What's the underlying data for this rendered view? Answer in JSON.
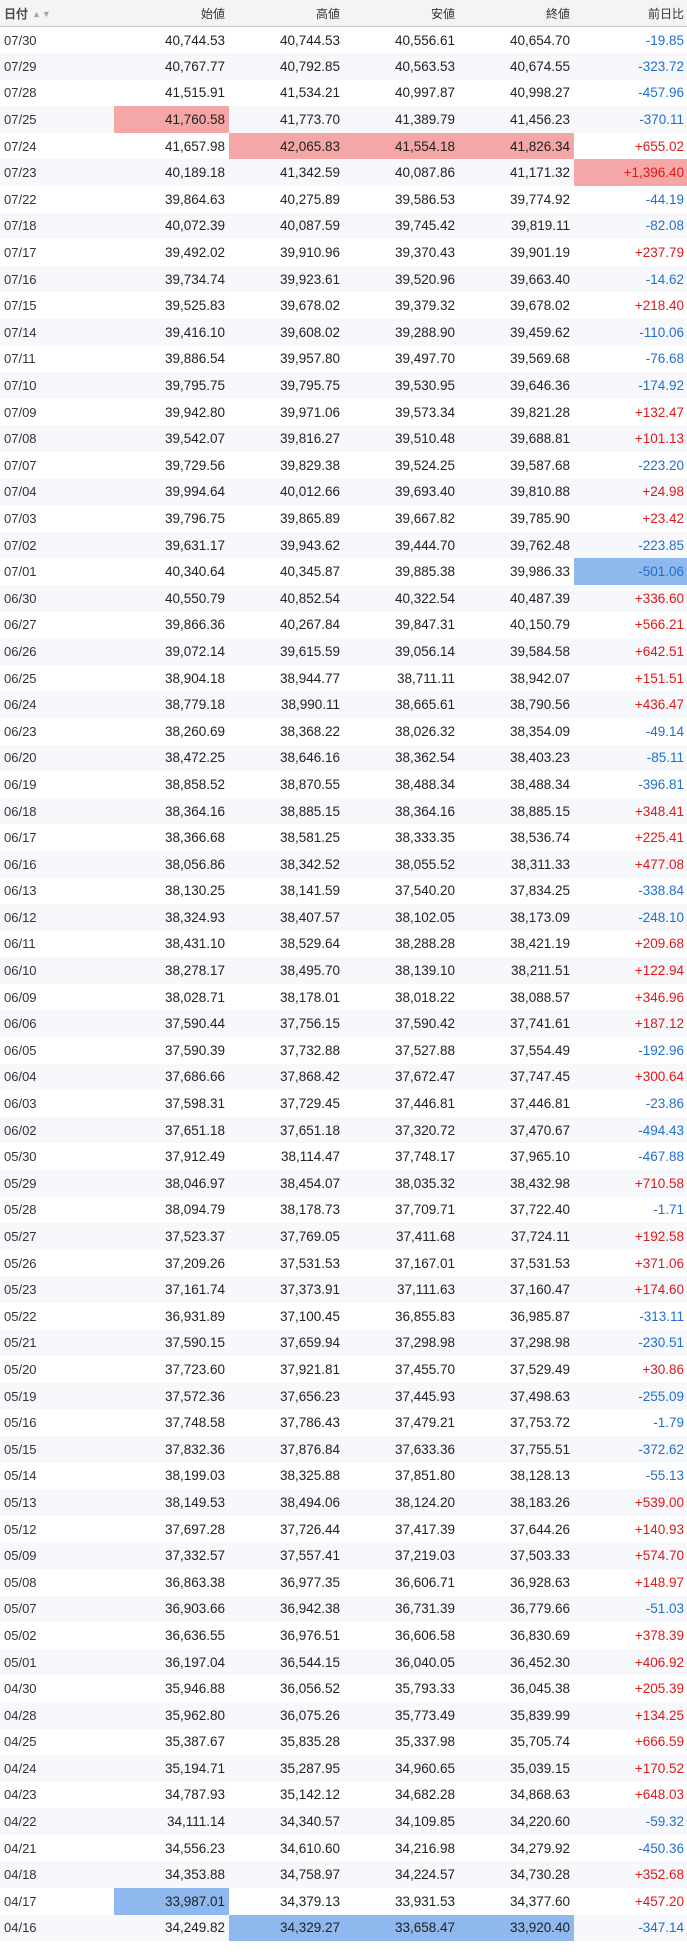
{
  "table": {
    "headers": {
      "date": "日付",
      "open": "始値",
      "high": "高値",
      "low": "安値",
      "close": "終値",
      "change": "前日比"
    },
    "rows": [
      [
        "07/30",
        "40,744.53",
        "40,744.53",
        "40,556.61",
        "40,654.70",
        "-19.85"
      ],
      [
        "07/29",
        "40,767.77",
        "40,792.85",
        "40,563.53",
        "40,674.55",
        "-323.72"
      ],
      [
        "07/28",
        "41,515.91",
        "41,534.21",
        "40,997.87",
        "40,998.27",
        "-457.96"
      ],
      [
        "07/25",
        "41,760.58",
        "41,773.70",
        "41,389.79",
        "41,456.23",
        "-370.11"
      ],
      [
        "07/24",
        "41,657.98",
        "42,065.83",
        "41,554.18",
        "41,826.34",
        "+655.02"
      ],
      [
        "07/23",
        "40,189.18",
        "41,342.59",
        "40,087.86",
        "41,171.32",
        "+1,396.40"
      ],
      [
        "07/22",
        "39,864.63",
        "40,275.89",
        "39,586.53",
        "39,774.92",
        "-44.19"
      ],
      [
        "07/18",
        "40,072.39",
        "40,087.59",
        "39,745.42",
        "39,819.11",
        "-82.08"
      ],
      [
        "07/17",
        "39,492.02",
        "39,910.96",
        "39,370.43",
        "39,901.19",
        "+237.79"
      ],
      [
        "07/16",
        "39,734.74",
        "39,923.61",
        "39,520.96",
        "39,663.40",
        "-14.62"
      ],
      [
        "07/15",
        "39,525.83",
        "39,678.02",
        "39,379.32",
        "39,678.02",
        "+218.40"
      ],
      [
        "07/14",
        "39,416.10",
        "39,608.02",
        "39,288.90",
        "39,459.62",
        "-110.06"
      ],
      [
        "07/11",
        "39,886.54",
        "39,957.80",
        "39,497.70",
        "39,569.68",
        "-76.68"
      ],
      [
        "07/10",
        "39,795.75",
        "39,795.75",
        "39,530.95",
        "39,646.36",
        "-174.92"
      ],
      [
        "07/09",
        "39,942.80",
        "39,971.06",
        "39,573.34",
        "39,821.28",
        "+132.47"
      ],
      [
        "07/08",
        "39,542.07",
        "39,816.27",
        "39,510.48",
        "39,688.81",
        "+101.13"
      ],
      [
        "07/07",
        "39,729.56",
        "39,829.38",
        "39,524.25",
        "39,587.68",
        "-223.20"
      ],
      [
        "07/04",
        "39,994.64",
        "40,012.66",
        "39,693.40",
        "39,810.88",
        "+24.98"
      ],
      [
        "07/03",
        "39,796.75",
        "39,865.89",
        "39,667.82",
        "39,785.90",
        "+23.42"
      ],
      [
        "07/02",
        "39,631.17",
        "39,943.62",
        "39,444.70",
        "39,762.48",
        "-223.85"
      ],
      [
        "07/01",
        "40,340.64",
        "40,345.87",
        "39,885.38",
        "39,986.33",
        "-501.06"
      ],
      [
        "06/30",
        "40,550.79",
        "40,852.54",
        "40,322.54",
        "40,487.39",
        "+336.60"
      ],
      [
        "06/27",
        "39,866.36",
        "40,267.84",
        "39,847.31",
        "40,150.79",
        "+566.21"
      ],
      [
        "06/26",
        "39,072.14",
        "39,615.59",
        "39,056.14",
        "39,584.58",
        "+642.51"
      ],
      [
        "06/25",
        "38,904.18",
        "38,944.77",
        "38,711.11",
        "38,942.07",
        "+151.51"
      ],
      [
        "06/24",
        "38,779.18",
        "38,990.11",
        "38,665.61",
        "38,790.56",
        "+436.47"
      ],
      [
        "06/23",
        "38,260.69",
        "38,368.22",
        "38,026.32",
        "38,354.09",
        "-49.14"
      ],
      [
        "06/20",
        "38,472.25",
        "38,646.16",
        "38,362.54",
        "38,403.23",
        "-85.11"
      ],
      [
        "06/19",
        "38,858.52",
        "38,870.55",
        "38,488.34",
        "38,488.34",
        "-396.81"
      ],
      [
        "06/18",
        "38,364.16",
        "38,885.15",
        "38,364.16",
        "38,885.15",
        "+348.41"
      ],
      [
        "06/17",
        "38,366.68",
        "38,581.25",
        "38,333.35",
        "38,536.74",
        "+225.41"
      ],
      [
        "06/16",
        "38,056.86",
        "38,342.52",
        "38,055.52",
        "38,311.33",
        "+477.08"
      ],
      [
        "06/13",
        "38,130.25",
        "38,141.59",
        "37,540.20",
        "37,834.25",
        "-338.84"
      ],
      [
        "06/12",
        "38,324.93",
        "38,407.57",
        "38,102.05",
        "38,173.09",
        "-248.10"
      ],
      [
        "06/11",
        "38,431.10",
        "38,529.64",
        "38,288.28",
        "38,421.19",
        "+209.68"
      ],
      [
        "06/10",
        "38,278.17",
        "38,495.70",
        "38,139.10",
        "38,211.51",
        "+122.94"
      ],
      [
        "06/09",
        "38,028.71",
        "38,178.01",
        "38,018.22",
        "38,088.57",
        "+346.96"
      ],
      [
        "06/06",
        "37,590.44",
        "37,756.15",
        "37,590.42",
        "37,741.61",
        "+187.12"
      ],
      [
        "06/05",
        "37,590.39",
        "37,732.88",
        "37,527.88",
        "37,554.49",
        "-192.96"
      ],
      [
        "06/04",
        "37,686.66",
        "37,868.42",
        "37,672.47",
        "37,747.45",
        "+300.64"
      ],
      [
        "06/03",
        "37,598.31",
        "37,729.45",
        "37,446.81",
        "37,446.81",
        "-23.86"
      ],
      [
        "06/02",
        "37,651.18",
        "37,651.18",
        "37,320.72",
        "37,470.67",
        "-494.43"
      ],
      [
        "05/30",
        "37,912.49",
        "38,114.47",
        "37,748.17",
        "37,965.10",
        "-467.88"
      ],
      [
        "05/29",
        "38,046.97",
        "38,454.07",
        "38,035.32",
        "38,432.98",
        "+710.58"
      ],
      [
        "05/28",
        "38,094.79",
        "38,178.73",
        "37,709.71",
        "37,722.40",
        "-1.71"
      ],
      [
        "05/27",
        "37,523.37",
        "37,769.05",
        "37,411.68",
        "37,724.11",
        "+192.58"
      ],
      [
        "05/26",
        "37,209.26",
        "37,531.53",
        "37,167.01",
        "37,531.53",
        "+371.06"
      ],
      [
        "05/23",
        "37,161.74",
        "37,373.91",
        "37,111.63",
        "37,160.47",
        "+174.60"
      ],
      [
        "05/22",
        "36,931.89",
        "37,100.45",
        "36,855.83",
        "36,985.87",
        "-313.11"
      ],
      [
        "05/21",
        "37,590.15",
        "37,659.94",
        "37,298.98",
        "37,298.98",
        "-230.51"
      ],
      [
        "05/20",
        "37,723.60",
        "37,921.81",
        "37,455.70",
        "37,529.49",
        "+30.86"
      ],
      [
        "05/19",
        "37,572.36",
        "37,656.23",
        "37,445.93",
        "37,498.63",
        "-255.09"
      ],
      [
        "05/16",
        "37,748.58",
        "37,786.43",
        "37,479.21",
        "37,753.72",
        "-1.79"
      ],
      [
        "05/15",
        "37,832.36",
        "37,876.84",
        "37,633.36",
        "37,755.51",
        "-372.62"
      ],
      [
        "05/14",
        "38,199.03",
        "38,325.88",
        "37,851.80",
        "38,128.13",
        "-55.13"
      ],
      [
        "05/13",
        "38,149.53",
        "38,494.06",
        "38,124.20",
        "38,183.26",
        "+539.00"
      ],
      [
        "05/12",
        "37,697.28",
        "37,726.44",
        "37,417.39",
        "37,644.26",
        "+140.93"
      ],
      [
        "05/09",
        "37,332.57",
        "37,557.41",
        "37,219.03",
        "37,503.33",
        "+574.70"
      ],
      [
        "05/08",
        "36,863.38",
        "36,977.35",
        "36,606.71",
        "36,928.63",
        "+148.97"
      ],
      [
        "05/07",
        "36,903.66",
        "36,942.38",
        "36,731.39",
        "36,779.66",
        "-51.03"
      ],
      [
        "05/02",
        "36,636.55",
        "36,976.51",
        "36,606.58",
        "36,830.69",
        "+378.39"
      ],
      [
        "05/01",
        "36,197.04",
        "36,544.15",
        "36,040.05",
        "36,452.30",
        "+406.92"
      ],
      [
        "04/30",
        "35,946.88",
        "36,056.52",
        "35,793.33",
        "36,045.38",
        "+205.39"
      ],
      [
        "04/28",
        "35,962.80",
        "36,075.26",
        "35,773.49",
        "35,839.99",
        "+134.25"
      ],
      [
        "04/25",
        "35,387.67",
        "35,835.28",
        "35,337.98",
        "35,705.74",
        "+666.59"
      ],
      [
        "04/24",
        "35,194.71",
        "35,287.95",
        "34,960.65",
        "35,039.15",
        "+170.52"
      ],
      [
        "04/23",
        "34,787.93",
        "35,142.12",
        "34,682.28",
        "34,868.63",
        "+648.03"
      ],
      [
        "04/22",
        "34,111.14",
        "34,340.57",
        "34,109.85",
        "34,220.60",
        "-59.32"
      ],
      [
        "04/21",
        "34,556.23",
        "34,610.60",
        "34,216.98",
        "34,279.92",
        "-450.36"
      ],
      [
        "04/18",
        "34,353.88",
        "34,758.97",
        "34,224.57",
        "34,730.28",
        "+352.68"
      ],
      [
        "04/17",
        "33,987.01",
        "34,379.13",
        "33,931.53",
        "34,377.60",
        "+457.20"
      ],
      [
        "04/16",
        "34,249.82",
        "34,329.27",
        "33,658.47",
        "33,920.40",
        "-347.14"
      ]
    ],
    "highlights": [
      {
        "row": 3,
        "col": 1,
        "color": "#f5a6a6"
      },
      {
        "row": 4,
        "col": 2,
        "color": "#f5a6a6"
      },
      {
        "row": 4,
        "col": 3,
        "color": "#f5a6a6"
      },
      {
        "row": 4,
        "col": 4,
        "color": "#f5a6a6"
      },
      {
        "row": 5,
        "col": 5,
        "color": "#f5a6a6"
      },
      {
        "row": 20,
        "col": 5,
        "color": "#8fb8ef"
      },
      {
        "row": 70,
        "col": 1,
        "color": "#8fb8ef"
      },
      {
        "row": 71,
        "col": 2,
        "color": "#8fb8ef"
      },
      {
        "row": 71,
        "col": 3,
        "color": "#8fb8ef"
      },
      {
        "row": 71,
        "col": 4,
        "color": "#8fb8ef"
      }
    ],
    "sort_icon": "sort-arrows-icon",
    "colors": {
      "positive": "#e01818",
      "negative": "#1f6fd1"
    }
  }
}
